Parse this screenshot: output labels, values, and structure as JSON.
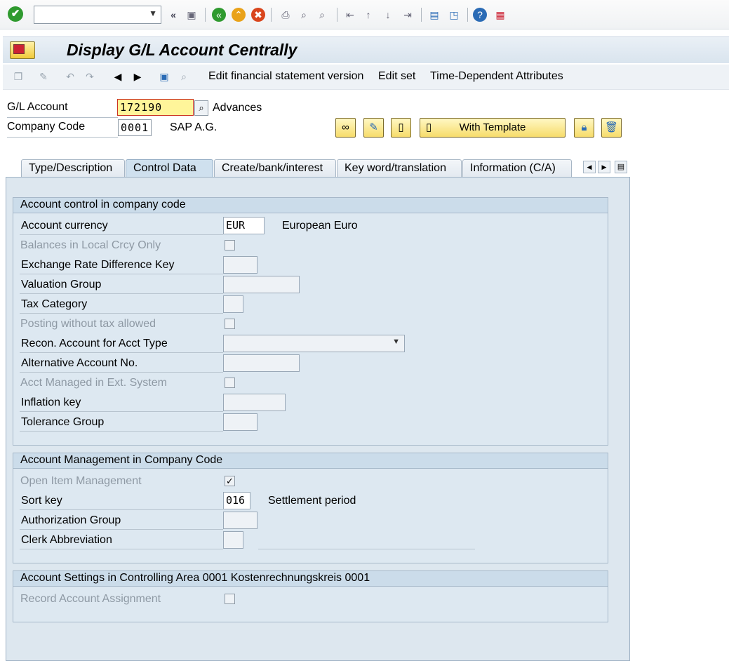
{
  "system_toolbar": {
    "command_field": "",
    "icons": [
      "enter-icon",
      "back-icon",
      "save-icon",
      "back-green-icon",
      "exit-icon",
      "cancel-icon",
      "print-icon",
      "find-icon",
      "find-next-icon",
      "first-page-icon",
      "previous-page-icon",
      "next-page-icon",
      "last-page-icon",
      "new-session-icon",
      "shortcut-icon",
      "help-icon",
      "customize-layout-icon"
    ]
  },
  "title": "Display G/L Account Centrally",
  "app_toolbar": {
    "items": [
      "Edit financial statement version",
      "Edit set",
      "Time-Dependent Attributes"
    ]
  },
  "header": {
    "gl_account_label": "G/L Account",
    "gl_account_value": "172190",
    "gl_account_desc": "Advances",
    "company_code_label": "Company Code",
    "company_code_value": "0001",
    "company_code_desc": "SAP A.G.",
    "with_template_label": "With Template"
  },
  "tabs": [
    {
      "label": "Type/Description",
      "active": false
    },
    {
      "label": "Control Data",
      "active": true
    },
    {
      "label": "Create/bank/interest",
      "active": false
    },
    {
      "label": "Key word/translation",
      "active": false
    },
    {
      "label": "Information (C/A)",
      "active": false
    }
  ],
  "group1": {
    "title": "Account control in company code",
    "account_currency_label": "Account currency",
    "account_currency_value": "EUR",
    "account_currency_desc": "European Euro",
    "balances_local_label": "Balances in Local Crcy Only",
    "exchange_rate_label": "Exchange Rate Difference Key",
    "valuation_group_label": "Valuation Group",
    "tax_category_label": "Tax Category",
    "posting_without_tax_label": "Posting without tax allowed",
    "recon_account_label": "Recon. Account for Acct Type",
    "alt_account_label": "Alternative Account No.",
    "acct_managed_label": "Acct Managed in Ext. System",
    "inflation_key_label": "Inflation key",
    "tolerance_group_label": "Tolerance Group"
  },
  "group2": {
    "title": "Account Management in Company Code",
    "open_item_label": "Open Item Management",
    "open_item_checked": true,
    "sort_key_label": "Sort key",
    "sort_key_value": "016",
    "sort_key_desc": "Settlement period",
    "auth_group_label": "Authorization Group",
    "clerk_abbrev_label": "Clerk Abbreviation"
  },
  "group3": {
    "title": "Account Settings in Controlling Area 0001 Kostenrechnungskreis 0001",
    "record_assignment_label": "Record Account Assignment"
  }
}
